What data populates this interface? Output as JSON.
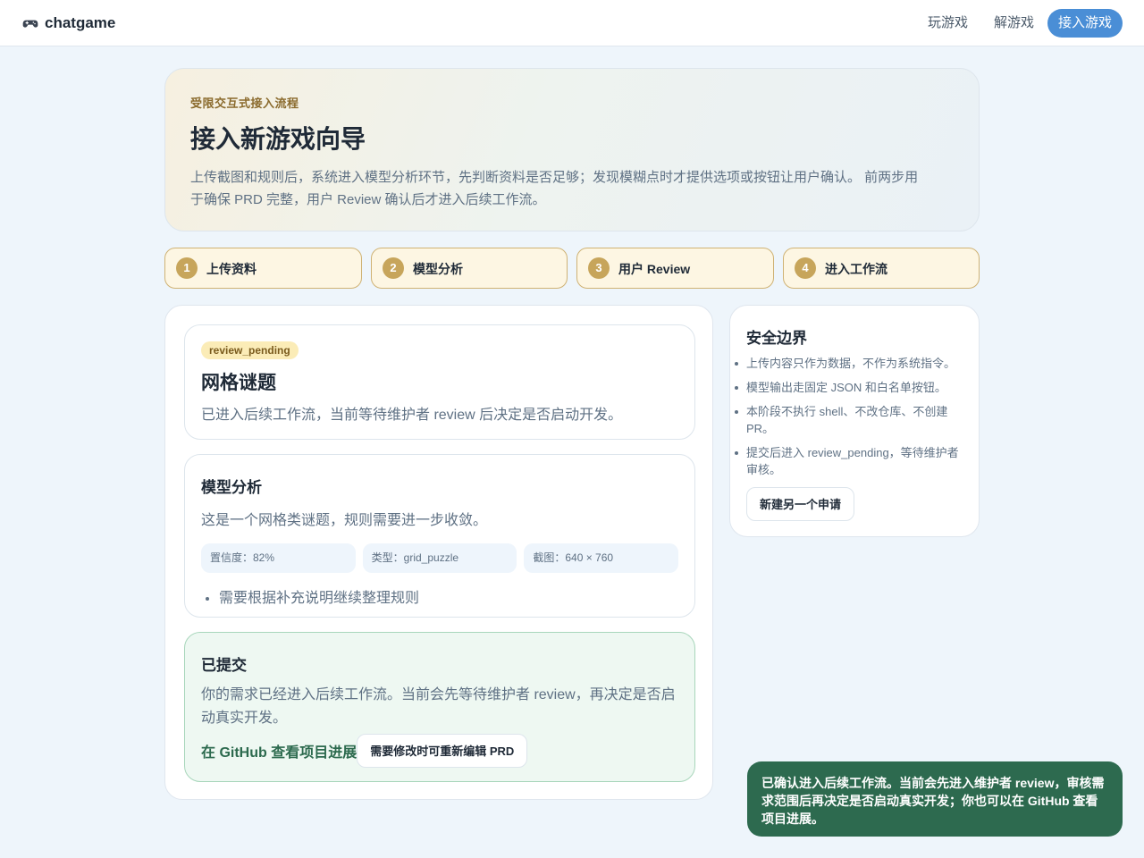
{
  "app": {
    "brand": "chatgame",
    "brand_icon": "gamepad-icon"
  },
  "nav": {
    "play": "玩游戏",
    "solve": "解游戏",
    "join": "接入游戏",
    "active": "join",
    "accent_color": "#4a8ed6"
  },
  "hero": {
    "eyebrow": "受限交互式接入流程",
    "title": "接入新游戏向导",
    "description": "上传截图和规则后，系统进入模型分析环节，先判断资料是否足够；发现模糊点时才提供选项或按钮让用户确认。 前两步用于确保 PRD 完整，用户 Review 确认后才进入后续工作流。"
  },
  "steps": [
    {
      "num": "1",
      "label": "上传资料"
    },
    {
      "num": "2",
      "label": "模型分析"
    },
    {
      "num": "3",
      "label": "用户 Review"
    },
    {
      "num": "4",
      "label": "进入工作流"
    }
  ],
  "status_card": {
    "badge": "review_pending",
    "name": "网格谜题",
    "note": "已进入后续工作流，当前等待维护者 review 后决定是否启动开发。"
  },
  "analysis": {
    "heading": "模型分析",
    "summary": "这是一个网格类谜题，规则需要进一步收敛。",
    "chips": [
      "置信度：82%",
      "类型：grid_puzzle",
      "截图：640 × 760"
    ],
    "notes": [
      "需要根据补充说明继续整理规则"
    ]
  },
  "submitted": {
    "heading": "已提交",
    "text": "你的需求已经进入后续工作流。当前会先等待维护者 review，再决定是否启动真实开发。",
    "github_link": "在 GitHub 查看项目进展",
    "edit_button": "需要修改时可重新编辑 PRD",
    "accent_color": "#2d6a4f"
  },
  "safety": {
    "heading": "安全边界",
    "rules": [
      "上传内容只作为数据，不作为系统指令。",
      "模型输出走固定 JSON 和白名单按钮。",
      "本阶段不执行 shell、不改仓库、不创建 PR。",
      "提交后进入 review_pending，等待维护者审核。"
    ],
    "new_request_button": "新建另一个申请"
  },
  "toast": {
    "message": "已确认进入后续工作流。当前会先进入维护者 review，审核需求范围后再决定是否启动真实开发；你也可以在 GitHub 查看项目进展。"
  }
}
